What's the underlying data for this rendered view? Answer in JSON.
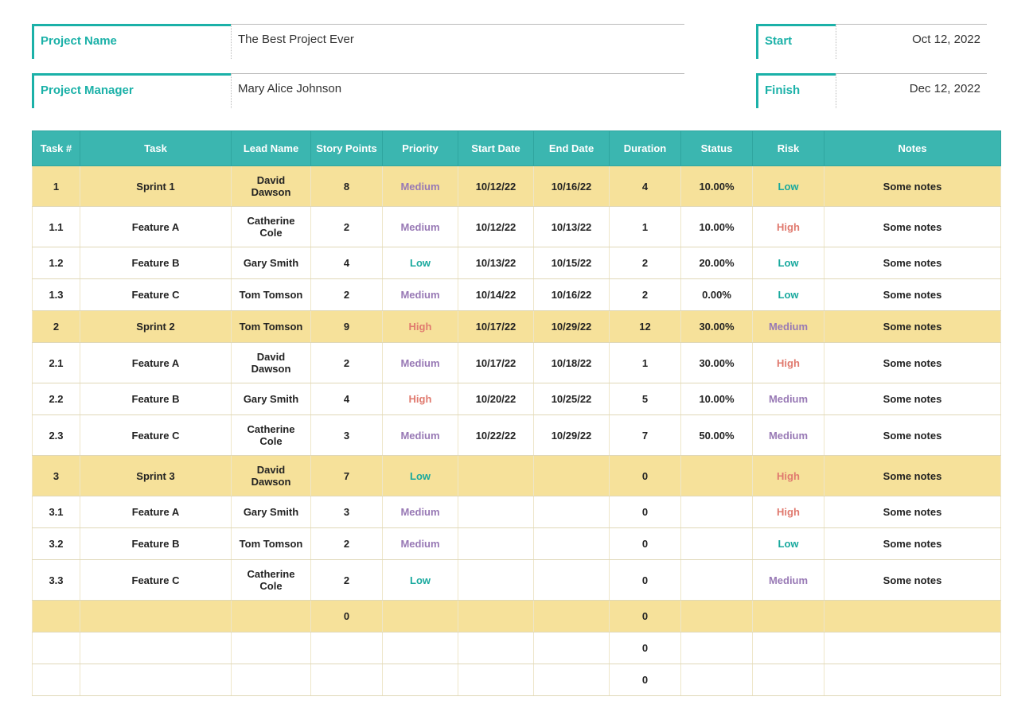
{
  "header": {
    "project_name_label": "Project Name",
    "project_name_value": "The Best Project Ever",
    "project_manager_label": "Project Manager",
    "project_manager_value": "Mary Alice Johnson",
    "start_label": "Start",
    "start_value": "Oct 12, 2022",
    "finish_label": "Finish",
    "finish_value": "Dec 12, 2022"
  },
  "table": {
    "columns": [
      "Task #",
      "Task",
      "Lead Name",
      "Story Points",
      "Priority",
      "Start Date",
      "End Date",
      "Duration",
      "Status",
      "Risk",
      "Notes"
    ],
    "rows": [
      {
        "sprint": true,
        "tasknum": "1",
        "task": "Sprint 1",
        "lead": "David Dawson",
        "sp": "8",
        "priority": "Medium",
        "start": "10/12/22",
        "end": "10/16/22",
        "duration": "4",
        "status": "10.00%",
        "risk": "Low",
        "notes": "Some notes"
      },
      {
        "sprint": false,
        "tasknum": "1.1",
        "task": "Feature A",
        "lead": "Catherine Cole",
        "sp": "2",
        "priority": "Medium",
        "start": "10/12/22",
        "end": "10/13/22",
        "duration": "1",
        "status": "10.00%",
        "risk": "High",
        "notes": "Some notes"
      },
      {
        "sprint": false,
        "tasknum": "1.2",
        "task": "Feature B",
        "lead": "Gary Smith",
        "sp": "4",
        "priority": "Low",
        "start": "10/13/22",
        "end": "10/15/22",
        "duration": "2",
        "status": "20.00%",
        "risk": "Low",
        "notes": "Some notes"
      },
      {
        "sprint": false,
        "tasknum": "1.3",
        "task": "Feature C",
        "lead": "Tom Tomson",
        "sp": "2",
        "priority": "Medium",
        "start": "10/14/22",
        "end": "10/16/22",
        "duration": "2",
        "status": "0.00%",
        "risk": "Low",
        "notes": "Some notes"
      },
      {
        "sprint": true,
        "tasknum": "2",
        "task": "Sprint 2",
        "lead": "Tom Tomson",
        "sp": "9",
        "priority": "High",
        "start": "10/17/22",
        "end": "10/29/22",
        "duration": "12",
        "status": "30.00%",
        "risk": "Medium",
        "notes": "Some notes"
      },
      {
        "sprint": false,
        "tasknum": "2.1",
        "task": "Feature A",
        "lead": "David Dawson",
        "sp": "2",
        "priority": "Medium",
        "start": "10/17/22",
        "end": "10/18/22",
        "duration": "1",
        "status": "30.00%",
        "risk": "High",
        "notes": "Some notes"
      },
      {
        "sprint": false,
        "tasknum": "2.2",
        "task": "Feature B",
        "lead": "Gary Smith",
        "sp": "4",
        "priority": "High",
        "start": "10/20/22",
        "end": "10/25/22",
        "duration": "5",
        "status": "10.00%",
        "risk": "Medium",
        "notes": "Some notes"
      },
      {
        "sprint": false,
        "tasknum": "2.3",
        "task": "Feature C",
        "lead": "Catherine Cole",
        "sp": "3",
        "priority": "Medium",
        "start": "10/22/22",
        "end": "10/29/22",
        "duration": "7",
        "status": "50.00%",
        "risk": "Medium",
        "notes": "Some notes"
      },
      {
        "sprint": true,
        "tasknum": "3",
        "task": "Sprint 3",
        "lead": "David Dawson",
        "sp": "7",
        "priority": "Low",
        "start": "",
        "end": "",
        "duration": "0",
        "status": "",
        "risk": "High",
        "notes": "Some notes"
      },
      {
        "sprint": false,
        "tasknum": "3.1",
        "task": "Feature A",
        "lead": "Gary Smith",
        "sp": "3",
        "priority": "Medium",
        "start": "",
        "end": "",
        "duration": "0",
        "status": "",
        "risk": "High",
        "notes": "Some notes"
      },
      {
        "sprint": false,
        "tasknum": "3.2",
        "task": "Feature B",
        "lead": "Tom Tomson",
        "sp": "2",
        "priority": "Medium",
        "start": "",
        "end": "",
        "duration": "0",
        "status": "",
        "risk": "Low",
        "notes": "Some notes"
      },
      {
        "sprint": false,
        "tasknum": "3.3",
        "task": "Feature C",
        "lead": "Catherine Cole",
        "sp": "2",
        "priority": "Low",
        "start": "",
        "end": "",
        "duration": "0",
        "status": "",
        "risk": "Medium",
        "notes": "Some notes"
      },
      {
        "sprint": true,
        "tasknum": "",
        "task": "",
        "lead": "",
        "sp": "0",
        "priority": "",
        "start": "",
        "end": "",
        "duration": "0",
        "status": "",
        "risk": "",
        "notes": ""
      },
      {
        "sprint": false,
        "tasknum": "",
        "task": "",
        "lead": "",
        "sp": "",
        "priority": "",
        "start": "",
        "end": "",
        "duration": "0",
        "status": "",
        "risk": "",
        "notes": ""
      },
      {
        "sprint": false,
        "tasknum": "",
        "task": "",
        "lead": "",
        "sp": "",
        "priority": "",
        "start": "",
        "end": "",
        "duration": "0",
        "status": "",
        "risk": "",
        "notes": ""
      }
    ]
  }
}
